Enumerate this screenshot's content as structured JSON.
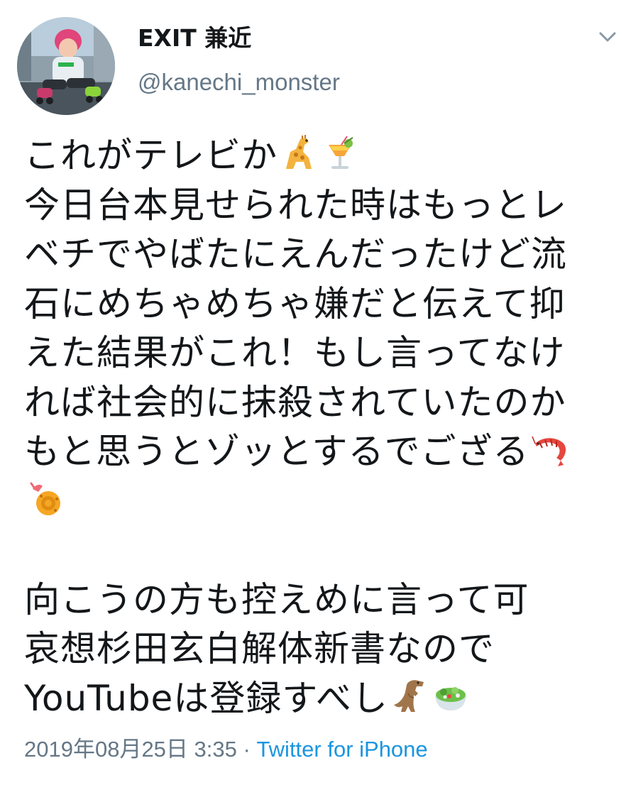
{
  "header": {
    "display_name": "EXIT 兼近",
    "handle": "@kanechi_monster"
  },
  "icons": {
    "more": "chevron-down-icon",
    "avatar": "profile-photo"
  },
  "tweet": {
    "lines": [
      "これがテレビか",
      "今日台本見せられた時はもっとレ",
      "ベチでやばたにえんだったけど流",
      "石にめちゃめちゃ嫌だと伝えて抑",
      "えた結果がこれ！もし言ってなけ",
      "れば社会的に抹殺されていたのか",
      "もと思うとゾッとするでござる",
      "",
      "",
      "向こうの方も控えめに言って可",
      "哀想杉田玄白解体新書なので",
      "YouTubeは登録すべし"
    ],
    "emojis": [
      "giraffe",
      "tropical-drink",
      "shrimp",
      "fried-shrimp",
      "t-rex",
      "green-salad"
    ]
  },
  "meta": {
    "timestamp": "2019年08月25日 3:35",
    "separator": " · ",
    "source": "Twitter for iPhone"
  },
  "colors": {
    "text": "#14171a",
    "secondary": "#657786",
    "link": "#1b95e0"
  }
}
